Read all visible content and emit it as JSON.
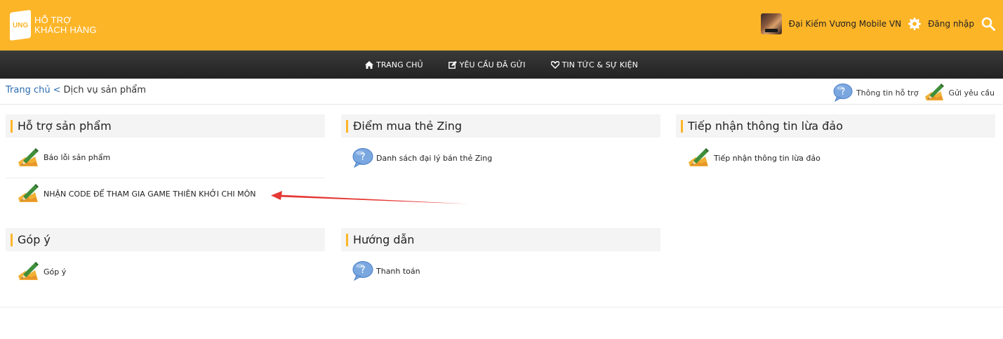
{
  "header": {
    "logo_mark": "UNG",
    "logo_line1": "HỖ TRỢ",
    "logo_line2": "KHÁCH HÀNG",
    "game_name": "Đại Kiếm Vương Mobile VN",
    "login_label": "Đăng nhập",
    "brand_color": "#fdb528",
    "icons": [
      "game-avatar",
      "gear-icon",
      "search-icon"
    ]
  },
  "nav": {
    "items": [
      {
        "label": "TRANG CHỦ",
        "icon": "home-icon"
      },
      {
        "label": "YÊU CẦU ĐÃ GỬI",
        "icon": "edit-icon"
      },
      {
        "label": "TIN TỨC & SỰ KIỆN",
        "icon": "heart-icon"
      }
    ]
  },
  "breadcrumb": {
    "home": "Trang chủ",
    "separator": "<",
    "current": "Dịch vụ sản phẩm",
    "support_info": "Thông tin hỗ trợ",
    "send_request": "Gửi yêu cầu"
  },
  "sections": {
    "product_support": {
      "title": "Hỗ trợ sản phẩm",
      "items": [
        "Báo lỗi sản phẩm",
        "NHẬN CODE ĐỂ THAM GIA GAME THIÊN KHỞI CHI MÔN"
      ]
    },
    "zing_card": {
      "title": "Điểm mua thẻ Zing",
      "items": [
        "Danh sách đại lý bán thẻ Zing"
      ]
    },
    "fraud": {
      "title": "Tiếp nhận thông tin lừa đảo",
      "items": [
        "Tiếp nhận thông tin lừa đảo"
      ]
    },
    "feedback": {
      "title": "Góp ý",
      "items": [
        "Góp ý"
      ]
    },
    "guide": {
      "title": "Hướng dẫn",
      "items": [
        "Thanh toán"
      ]
    }
  },
  "annotation": {
    "arrow_color": "#e53935"
  }
}
